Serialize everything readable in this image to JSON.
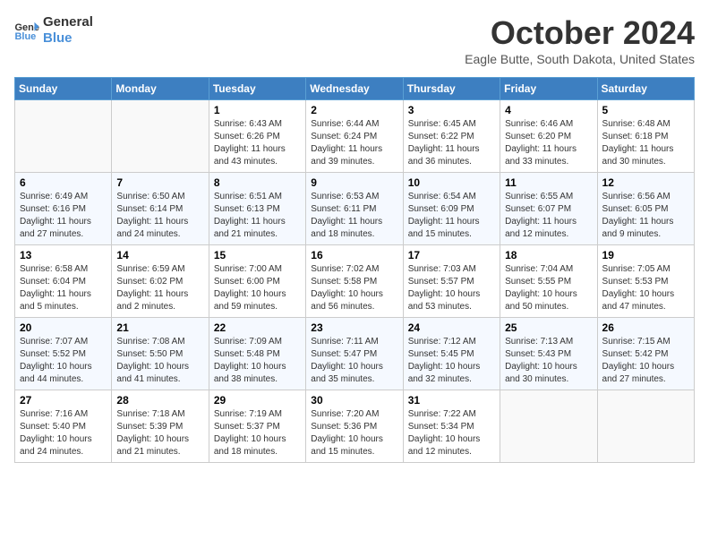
{
  "logo": {
    "line1": "General",
    "line2": "Blue"
  },
  "title": "October 2024",
  "location": "Eagle Butte, South Dakota, United States",
  "weekdays": [
    "Sunday",
    "Monday",
    "Tuesday",
    "Wednesday",
    "Thursday",
    "Friday",
    "Saturday"
  ],
  "weeks": [
    [
      {
        "day": "",
        "empty": true
      },
      {
        "day": "",
        "empty": true
      },
      {
        "day": "1",
        "sunrise": "Sunrise: 6:43 AM",
        "sunset": "Sunset: 6:26 PM",
        "daylight": "Daylight: 11 hours and 43 minutes."
      },
      {
        "day": "2",
        "sunrise": "Sunrise: 6:44 AM",
        "sunset": "Sunset: 6:24 PM",
        "daylight": "Daylight: 11 hours and 39 minutes."
      },
      {
        "day": "3",
        "sunrise": "Sunrise: 6:45 AM",
        "sunset": "Sunset: 6:22 PM",
        "daylight": "Daylight: 11 hours and 36 minutes."
      },
      {
        "day": "4",
        "sunrise": "Sunrise: 6:46 AM",
        "sunset": "Sunset: 6:20 PM",
        "daylight": "Daylight: 11 hours and 33 minutes."
      },
      {
        "day": "5",
        "sunrise": "Sunrise: 6:48 AM",
        "sunset": "Sunset: 6:18 PM",
        "daylight": "Daylight: 11 hours and 30 minutes."
      }
    ],
    [
      {
        "day": "6",
        "sunrise": "Sunrise: 6:49 AM",
        "sunset": "Sunset: 6:16 PM",
        "daylight": "Daylight: 11 hours and 27 minutes."
      },
      {
        "day": "7",
        "sunrise": "Sunrise: 6:50 AM",
        "sunset": "Sunset: 6:14 PM",
        "daylight": "Daylight: 11 hours and 24 minutes."
      },
      {
        "day": "8",
        "sunrise": "Sunrise: 6:51 AM",
        "sunset": "Sunset: 6:13 PM",
        "daylight": "Daylight: 11 hours and 21 minutes."
      },
      {
        "day": "9",
        "sunrise": "Sunrise: 6:53 AM",
        "sunset": "Sunset: 6:11 PM",
        "daylight": "Daylight: 11 hours and 18 minutes."
      },
      {
        "day": "10",
        "sunrise": "Sunrise: 6:54 AM",
        "sunset": "Sunset: 6:09 PM",
        "daylight": "Daylight: 11 hours and 15 minutes."
      },
      {
        "day": "11",
        "sunrise": "Sunrise: 6:55 AM",
        "sunset": "Sunset: 6:07 PM",
        "daylight": "Daylight: 11 hours and 12 minutes."
      },
      {
        "day": "12",
        "sunrise": "Sunrise: 6:56 AM",
        "sunset": "Sunset: 6:05 PM",
        "daylight": "Daylight: 11 hours and 9 minutes."
      }
    ],
    [
      {
        "day": "13",
        "sunrise": "Sunrise: 6:58 AM",
        "sunset": "Sunset: 6:04 PM",
        "daylight": "Daylight: 11 hours and 5 minutes."
      },
      {
        "day": "14",
        "sunrise": "Sunrise: 6:59 AM",
        "sunset": "Sunset: 6:02 PM",
        "daylight": "Daylight: 11 hours and 2 minutes."
      },
      {
        "day": "15",
        "sunrise": "Sunrise: 7:00 AM",
        "sunset": "Sunset: 6:00 PM",
        "daylight": "Daylight: 10 hours and 59 minutes."
      },
      {
        "day": "16",
        "sunrise": "Sunrise: 7:02 AM",
        "sunset": "Sunset: 5:58 PM",
        "daylight": "Daylight: 10 hours and 56 minutes."
      },
      {
        "day": "17",
        "sunrise": "Sunrise: 7:03 AM",
        "sunset": "Sunset: 5:57 PM",
        "daylight": "Daylight: 10 hours and 53 minutes."
      },
      {
        "day": "18",
        "sunrise": "Sunrise: 7:04 AM",
        "sunset": "Sunset: 5:55 PM",
        "daylight": "Daylight: 10 hours and 50 minutes."
      },
      {
        "day": "19",
        "sunrise": "Sunrise: 7:05 AM",
        "sunset": "Sunset: 5:53 PM",
        "daylight": "Daylight: 10 hours and 47 minutes."
      }
    ],
    [
      {
        "day": "20",
        "sunrise": "Sunrise: 7:07 AM",
        "sunset": "Sunset: 5:52 PM",
        "daylight": "Daylight: 10 hours and 44 minutes."
      },
      {
        "day": "21",
        "sunrise": "Sunrise: 7:08 AM",
        "sunset": "Sunset: 5:50 PM",
        "daylight": "Daylight: 10 hours and 41 minutes."
      },
      {
        "day": "22",
        "sunrise": "Sunrise: 7:09 AM",
        "sunset": "Sunset: 5:48 PM",
        "daylight": "Daylight: 10 hours and 38 minutes."
      },
      {
        "day": "23",
        "sunrise": "Sunrise: 7:11 AM",
        "sunset": "Sunset: 5:47 PM",
        "daylight": "Daylight: 10 hours and 35 minutes."
      },
      {
        "day": "24",
        "sunrise": "Sunrise: 7:12 AM",
        "sunset": "Sunset: 5:45 PM",
        "daylight": "Daylight: 10 hours and 32 minutes."
      },
      {
        "day": "25",
        "sunrise": "Sunrise: 7:13 AM",
        "sunset": "Sunset: 5:43 PM",
        "daylight": "Daylight: 10 hours and 30 minutes."
      },
      {
        "day": "26",
        "sunrise": "Sunrise: 7:15 AM",
        "sunset": "Sunset: 5:42 PM",
        "daylight": "Daylight: 10 hours and 27 minutes."
      }
    ],
    [
      {
        "day": "27",
        "sunrise": "Sunrise: 7:16 AM",
        "sunset": "Sunset: 5:40 PM",
        "daylight": "Daylight: 10 hours and 24 minutes."
      },
      {
        "day": "28",
        "sunrise": "Sunrise: 7:18 AM",
        "sunset": "Sunset: 5:39 PM",
        "daylight": "Daylight: 10 hours and 21 minutes."
      },
      {
        "day": "29",
        "sunrise": "Sunrise: 7:19 AM",
        "sunset": "Sunset: 5:37 PM",
        "daylight": "Daylight: 10 hours and 18 minutes."
      },
      {
        "day": "30",
        "sunrise": "Sunrise: 7:20 AM",
        "sunset": "Sunset: 5:36 PM",
        "daylight": "Daylight: 10 hours and 15 minutes."
      },
      {
        "day": "31",
        "sunrise": "Sunrise: 7:22 AM",
        "sunset": "Sunset: 5:34 PM",
        "daylight": "Daylight: 10 hours and 12 minutes."
      },
      {
        "day": "",
        "empty": true
      },
      {
        "day": "",
        "empty": true
      }
    ]
  ]
}
